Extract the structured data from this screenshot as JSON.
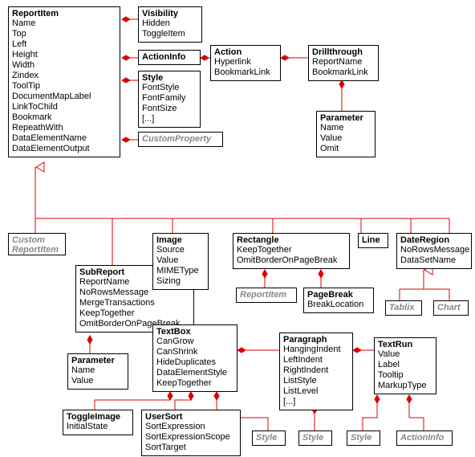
{
  "boxes": {
    "reportItem": {
      "title": "ReportItem",
      "attrs": [
        "Name",
        "Top",
        "Left",
        "Height",
        "Width",
        "Zindex",
        "ToolTip",
        "DocumentMapLabel",
        "LinkToChild",
        "Bookmark",
        "RepeathWith",
        "DataElementName",
        "DataElementOutput"
      ]
    },
    "visibility": {
      "title": "Visibility",
      "attrs": [
        "Hidden",
        "ToggleItem"
      ]
    },
    "actionInfo": {
      "title": "ActionInfo"
    },
    "style": {
      "title": "Style",
      "attrs": [
        "FontStyle",
        "FontFamily",
        "FontSize",
        "[...]"
      ]
    },
    "customProperty": {
      "title": "CustomProperty"
    },
    "action": {
      "title": "Action",
      "attrs": [
        "Hyperlink",
        "BookmarkLink"
      ]
    },
    "drillthrough": {
      "title": "Drillthrough",
      "attrs": [
        "ReportName",
        "BookmarkLink"
      ]
    },
    "parameterDrill": {
      "title": "Parameter",
      "attrs": [
        "Name",
        "Value",
        "Omit"
      ]
    },
    "customReportItem": {
      "title": "Custom\nReportItem"
    },
    "subReport": {
      "title": "SubReport",
      "attrs": [
        "ReportName",
        "NoRowsMessage",
        "MergeTransactions",
        "KeepTogether",
        "OmitBorderOnPageBreak"
      ]
    },
    "parameterSub": {
      "title": "Parameter",
      "attrs": [
        "Name",
        "Value"
      ]
    },
    "image": {
      "title": "Image",
      "attrs": [
        "Source",
        "Value",
        "MIMEType",
        "Sizing"
      ]
    },
    "textBox": {
      "title": "TextBox",
      "attrs": [
        "CanGrow",
        "CanShrink",
        "HideDuplicates",
        "DataElementStyle",
        "KeepTogether"
      ]
    },
    "toggleImage": {
      "title": "ToggleImage",
      "attrs": [
        "InitialState"
      ]
    },
    "userSort": {
      "title": "UserSort",
      "attrs": [
        "SortExpression",
        "SortExpressionScope",
        "SortTarget"
      ]
    },
    "rectangle": {
      "title": "Rectangle",
      "attrs": [
        "KeepTogether",
        "OmitBorderOnPageBreak"
      ]
    },
    "reportItemGhost": {
      "title": "ReportItem"
    },
    "pageBreak": {
      "title": "PageBreak",
      "attrs": [
        "BreakLocation"
      ]
    },
    "line": {
      "title": "Line"
    },
    "dateRegion": {
      "title": "DateRegion",
      "attrs": [
        "NoRowsMessage",
        "DataSetName"
      ]
    },
    "tablix": {
      "title": "Tablix"
    },
    "chart": {
      "title": "Chart"
    },
    "paragraph": {
      "title": "Paragraph",
      "attrs": [
        "HangingIndent",
        "LeftIndent",
        "RightIndent",
        "ListStyle",
        "ListLevel",
        "[...]"
      ]
    },
    "textRun": {
      "title": "TextRun",
      "attrs": [
        "Value",
        "Label",
        "Tooltip",
        "MarkupType"
      ]
    },
    "styleGhost1": {
      "title": "Style"
    },
    "styleGhost2": {
      "title": "Style"
    },
    "actionInfoGhost": {
      "title": "ActionInfo"
    }
  }
}
